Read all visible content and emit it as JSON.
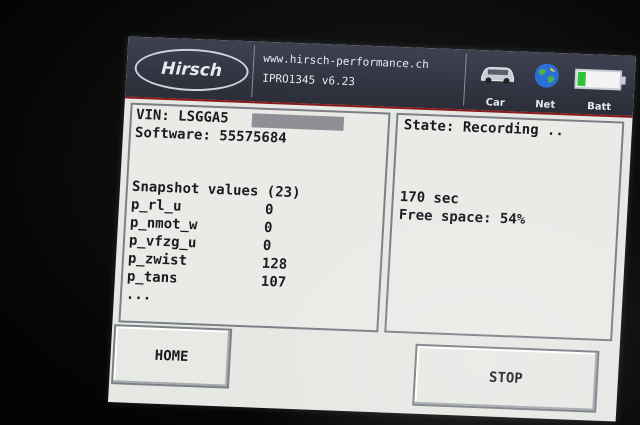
{
  "header": {
    "logo_text": "Hirsch",
    "website": "www.hirsch-performance.ch",
    "firmware": "IPRO1345 v6.23",
    "status": {
      "car_label": "Car",
      "net_label": "Net",
      "batt_label": "Batt",
      "battery_level": 0.2,
      "battery_color": "#2ec43a"
    }
  },
  "left_panel": {
    "vin": "VIN: LSGGA5",
    "software": "Software: 55575684",
    "snapshot_title": "Snapshot values (23)",
    "values": [
      {
        "name": "p_rl_u",
        "value": "0"
      },
      {
        "name": "p_nmot_w",
        "value": "0"
      },
      {
        "name": "p_vfzg_u",
        "value": "0"
      },
      {
        "name": "p_zwist",
        "value": "128"
      },
      {
        "name": "p_tans",
        "value": "107"
      }
    ],
    "more": "..."
  },
  "right_panel": {
    "state": "State: Recording ..",
    "time": "170 sec",
    "free_space": "Free space: 54%"
  },
  "buttons": {
    "home": "HOME",
    "stop": "STOP"
  },
  "colors": {
    "header_bg": "#2f313c",
    "accent_line": "#8a1a1a",
    "screen_bg": "#e6e8e4"
  }
}
